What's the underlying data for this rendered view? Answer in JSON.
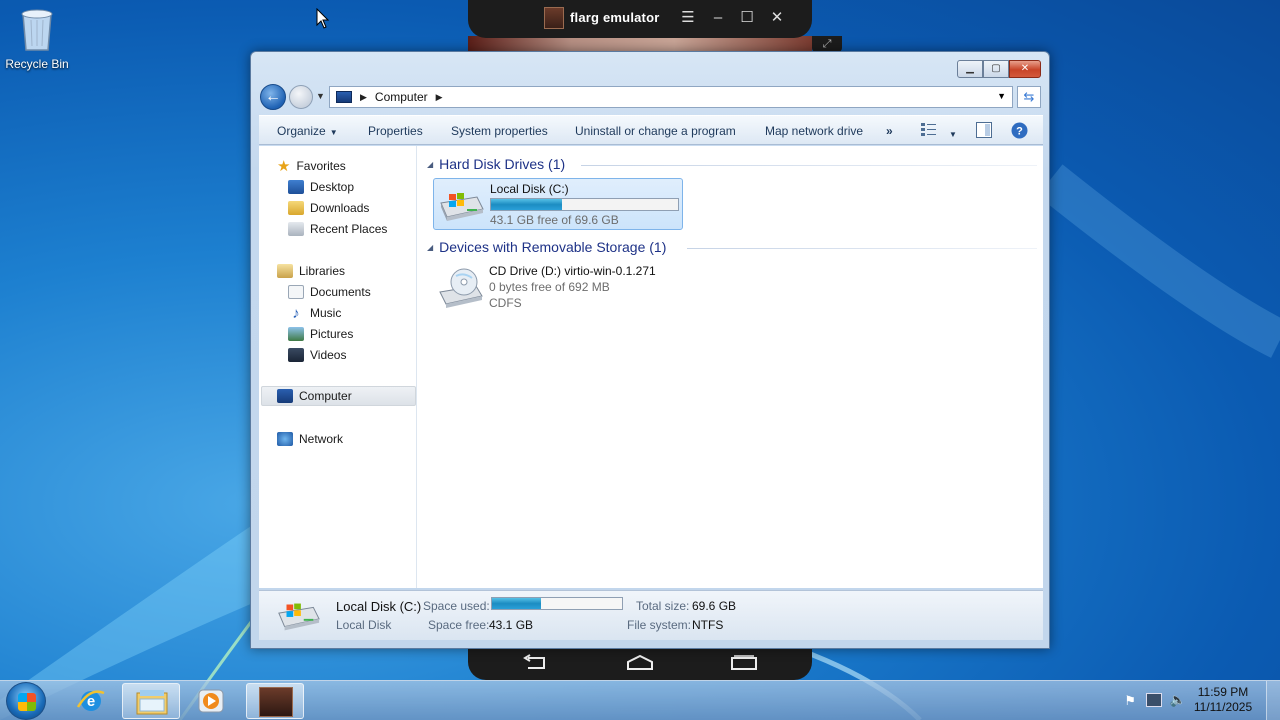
{
  "desktop": {
    "recycle_bin_label": "Recycle Bin"
  },
  "emulator": {
    "title": "flarg emulator"
  },
  "window": {
    "address": {
      "location": "Computer"
    },
    "toolbar": {
      "organize": "Organize",
      "properties": "Properties",
      "system_properties": "System properties",
      "uninstall": "Uninstall or change a program",
      "map_network_drive": "Map network drive",
      "more": "»"
    },
    "nav": {
      "favorites": "Favorites",
      "desktop": "Desktop",
      "downloads": "Downloads",
      "recent_places": "Recent Places",
      "libraries": "Libraries",
      "documents": "Documents",
      "music": "Music",
      "pictures": "Pictures",
      "videos": "Videos",
      "computer": "Computer",
      "network": "Network"
    },
    "groups": {
      "hdd_header": "Hard Disk Drives (1)",
      "removable_header": "Devices with Removable Storage (1)"
    },
    "drives": {
      "c": {
        "name": "Local Disk (C:)",
        "free_text": "43.1 GB free of 69.6 GB",
        "used_fraction": 0.38
      },
      "d": {
        "name": "CD Drive (D:) virtio-win-0.1.271",
        "free_text": "0 bytes free of 692 MB",
        "fs": "CDFS"
      }
    },
    "details": {
      "name": "Local Disk (C:)",
      "type": "Local Disk",
      "space_used_label": "Space used:",
      "space_free_label": "Space free:",
      "space_free": "43.1 GB",
      "total_size_label": "Total size:",
      "total_size": "69.6 GB",
      "file_system_label": "File system:",
      "file_system": "NTFS",
      "used_fraction": 0.38
    }
  },
  "taskbar": {
    "time": "11:59 PM",
    "date": "11/11/2025"
  },
  "colors": {
    "progress_fill": "#1c8cc2",
    "group_header": "#1e3287",
    "link_text": "#1e395b"
  }
}
